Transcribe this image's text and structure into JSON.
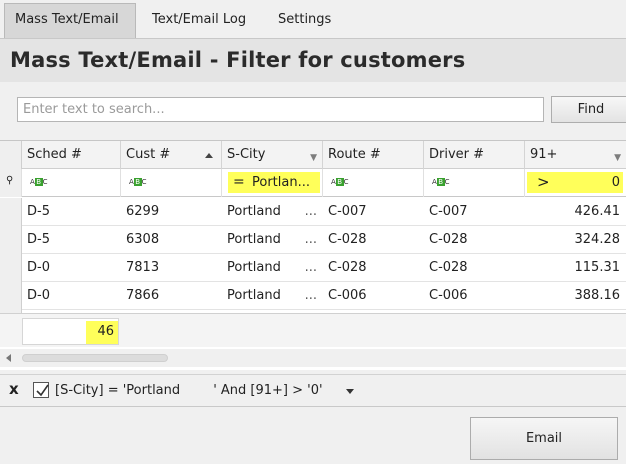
{
  "tabs": [
    {
      "label": "Mass Text/Email"
    },
    {
      "label": "Text/Email Log"
    },
    {
      "label": "Settings"
    }
  ],
  "page_title": "Mass Text/Email - Filter for customers",
  "search": {
    "placeholder": "Enter text to search...",
    "find_label": "Find"
  },
  "grid": {
    "columns": [
      "Sched #",
      "Cust #",
      "S-City",
      "Route #",
      "Driver #",
      "91+"
    ],
    "filters": {
      "s_city": "Portlan...",
      "s_city_op": "=",
      "col91_op": ">",
      "col91_value": "0"
    },
    "rows": [
      {
        "sched": "D-5",
        "cust": "6299",
        "city": "Portland",
        "route": "C-007",
        "driver": "C-007",
        "amt": "426.41"
      },
      {
        "sched": "D-5",
        "cust": "6308",
        "city": "Portland",
        "route": "C-028",
        "driver": "C-028",
        "amt": "324.28"
      },
      {
        "sched": "D-0",
        "cust": "7813",
        "city": "Portland",
        "route": "C-028",
        "driver": "C-028",
        "amt": "115.31"
      },
      {
        "sched": "D-0",
        "cust": "7866",
        "city": "Portland",
        "route": "C-006",
        "driver": "C-006",
        "amt": "388.16"
      }
    ],
    "ellipsis": "...",
    "footer_count": "46"
  },
  "filter_bar": {
    "close": "x",
    "expression": "[S-City] = 'Portland        ' And [91+] > '0'"
  },
  "email_label": "Email",
  "colors": {
    "highlight": "#ffff5a",
    "abc_green": "#3aa12f"
  }
}
